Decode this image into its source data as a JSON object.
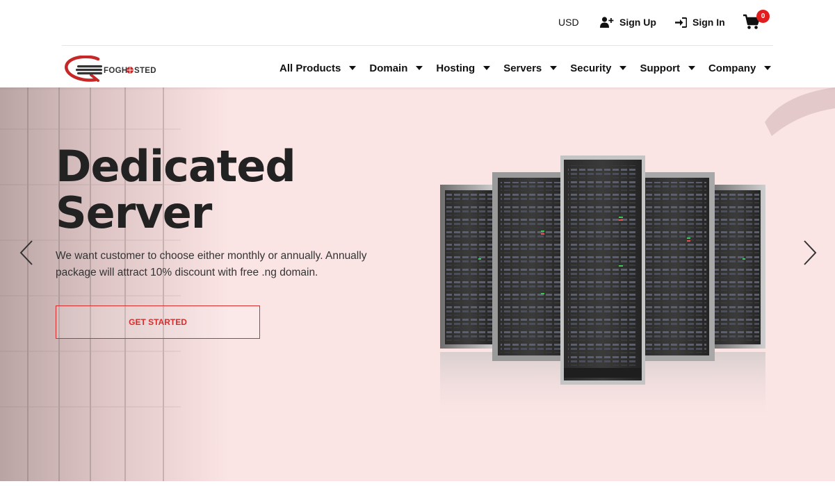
{
  "topbar": {
    "currency": "USD",
    "signup_label": "Sign Up",
    "signin_label": "Sign In",
    "cart_count": "0"
  },
  "brand": {
    "logo_text": "FOGHOSTED",
    "accent": "#d92c2c",
    "dark": "#222222"
  },
  "nav": {
    "items": [
      "All Products",
      "Domain",
      "Hosting",
      "Servers",
      "Security",
      "Support",
      "Company"
    ]
  },
  "hero": {
    "title_line1": "Dedicated",
    "title_line2": "Server",
    "description": "We want customer to choose either monthly or annually. Annually package will attract 10% discount with free .ng domain.",
    "cta_label": "GET STARTED",
    "background": "#fbe4e4"
  },
  "icons": {
    "signup": "user-plus-icon",
    "signin": "sign-in-icon",
    "cart": "shopping-cart-icon",
    "prev": "chevron-left-icon",
    "next": "chevron-right-icon"
  }
}
